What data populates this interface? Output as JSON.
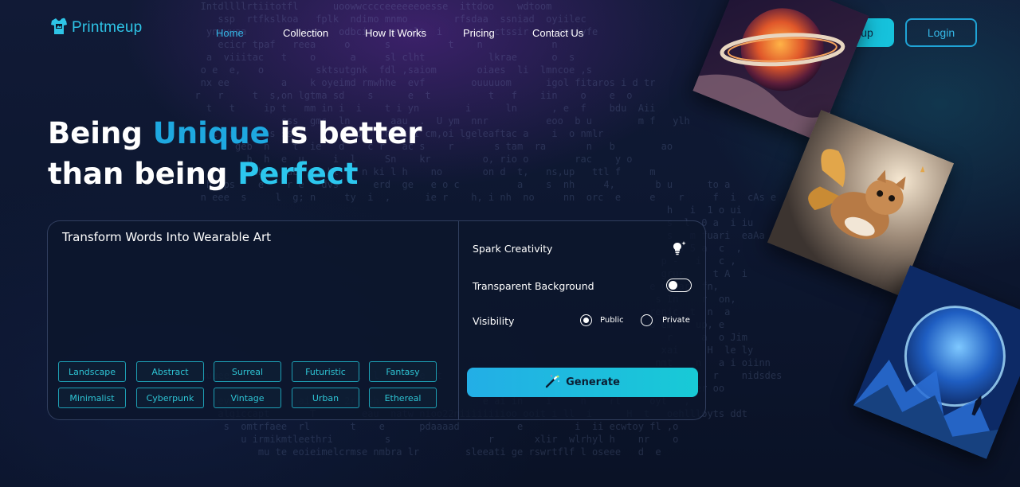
{
  "brand": {
    "name": "Printmeup"
  },
  "nav": {
    "items": [
      {
        "label": "Home",
        "active": true
      },
      {
        "label": "Collection"
      },
      {
        "label": "How It Works"
      },
      {
        "label": "Pricing"
      },
      {
        "label": "Contact Us"
      }
    ]
  },
  "auth": {
    "signup_label": "Signup",
    "login_label": "Login"
  },
  "hero": {
    "line1_pre": "Being ",
    "line1_highlight": "Unique",
    "line1_post": " is better",
    "line2_pre": "than being ",
    "line2_highlight": "Perfect"
  },
  "prompt": {
    "title": "Transform Words Into Wearable Art",
    "value": ""
  },
  "styles": {
    "tags": [
      "Landscape",
      "Abstract",
      "Surreal",
      "Futuristic",
      "Fantasy",
      "Minimalist",
      "Cyberpunk",
      "Vintage",
      "Urban",
      "Ethereal"
    ]
  },
  "options": {
    "spark_label": "Spark Creativity",
    "spark_icon": "lightbulb-sparkle-icon",
    "transparent_label": "Transparent Background",
    "transparent_on": false,
    "visibility_label": "Visibility",
    "visibility_options": [
      "Public",
      "Private"
    ],
    "visibility_selected": "Public"
  },
  "generate": {
    "label": "Generate",
    "icon": "magic-wand-icon"
  },
  "gallery": {
    "images": [
      "planet-ring-art",
      "flying-cat-art",
      "blue-moon-landscape-art"
    ]
  },
  "colors": {
    "accent": "#1ea8e0",
    "accent_bright": "#2cc7ee",
    "signup_bg": "#16c2dc",
    "tag_border": "#1d9fb4",
    "background": "#0c1528"
  }
}
